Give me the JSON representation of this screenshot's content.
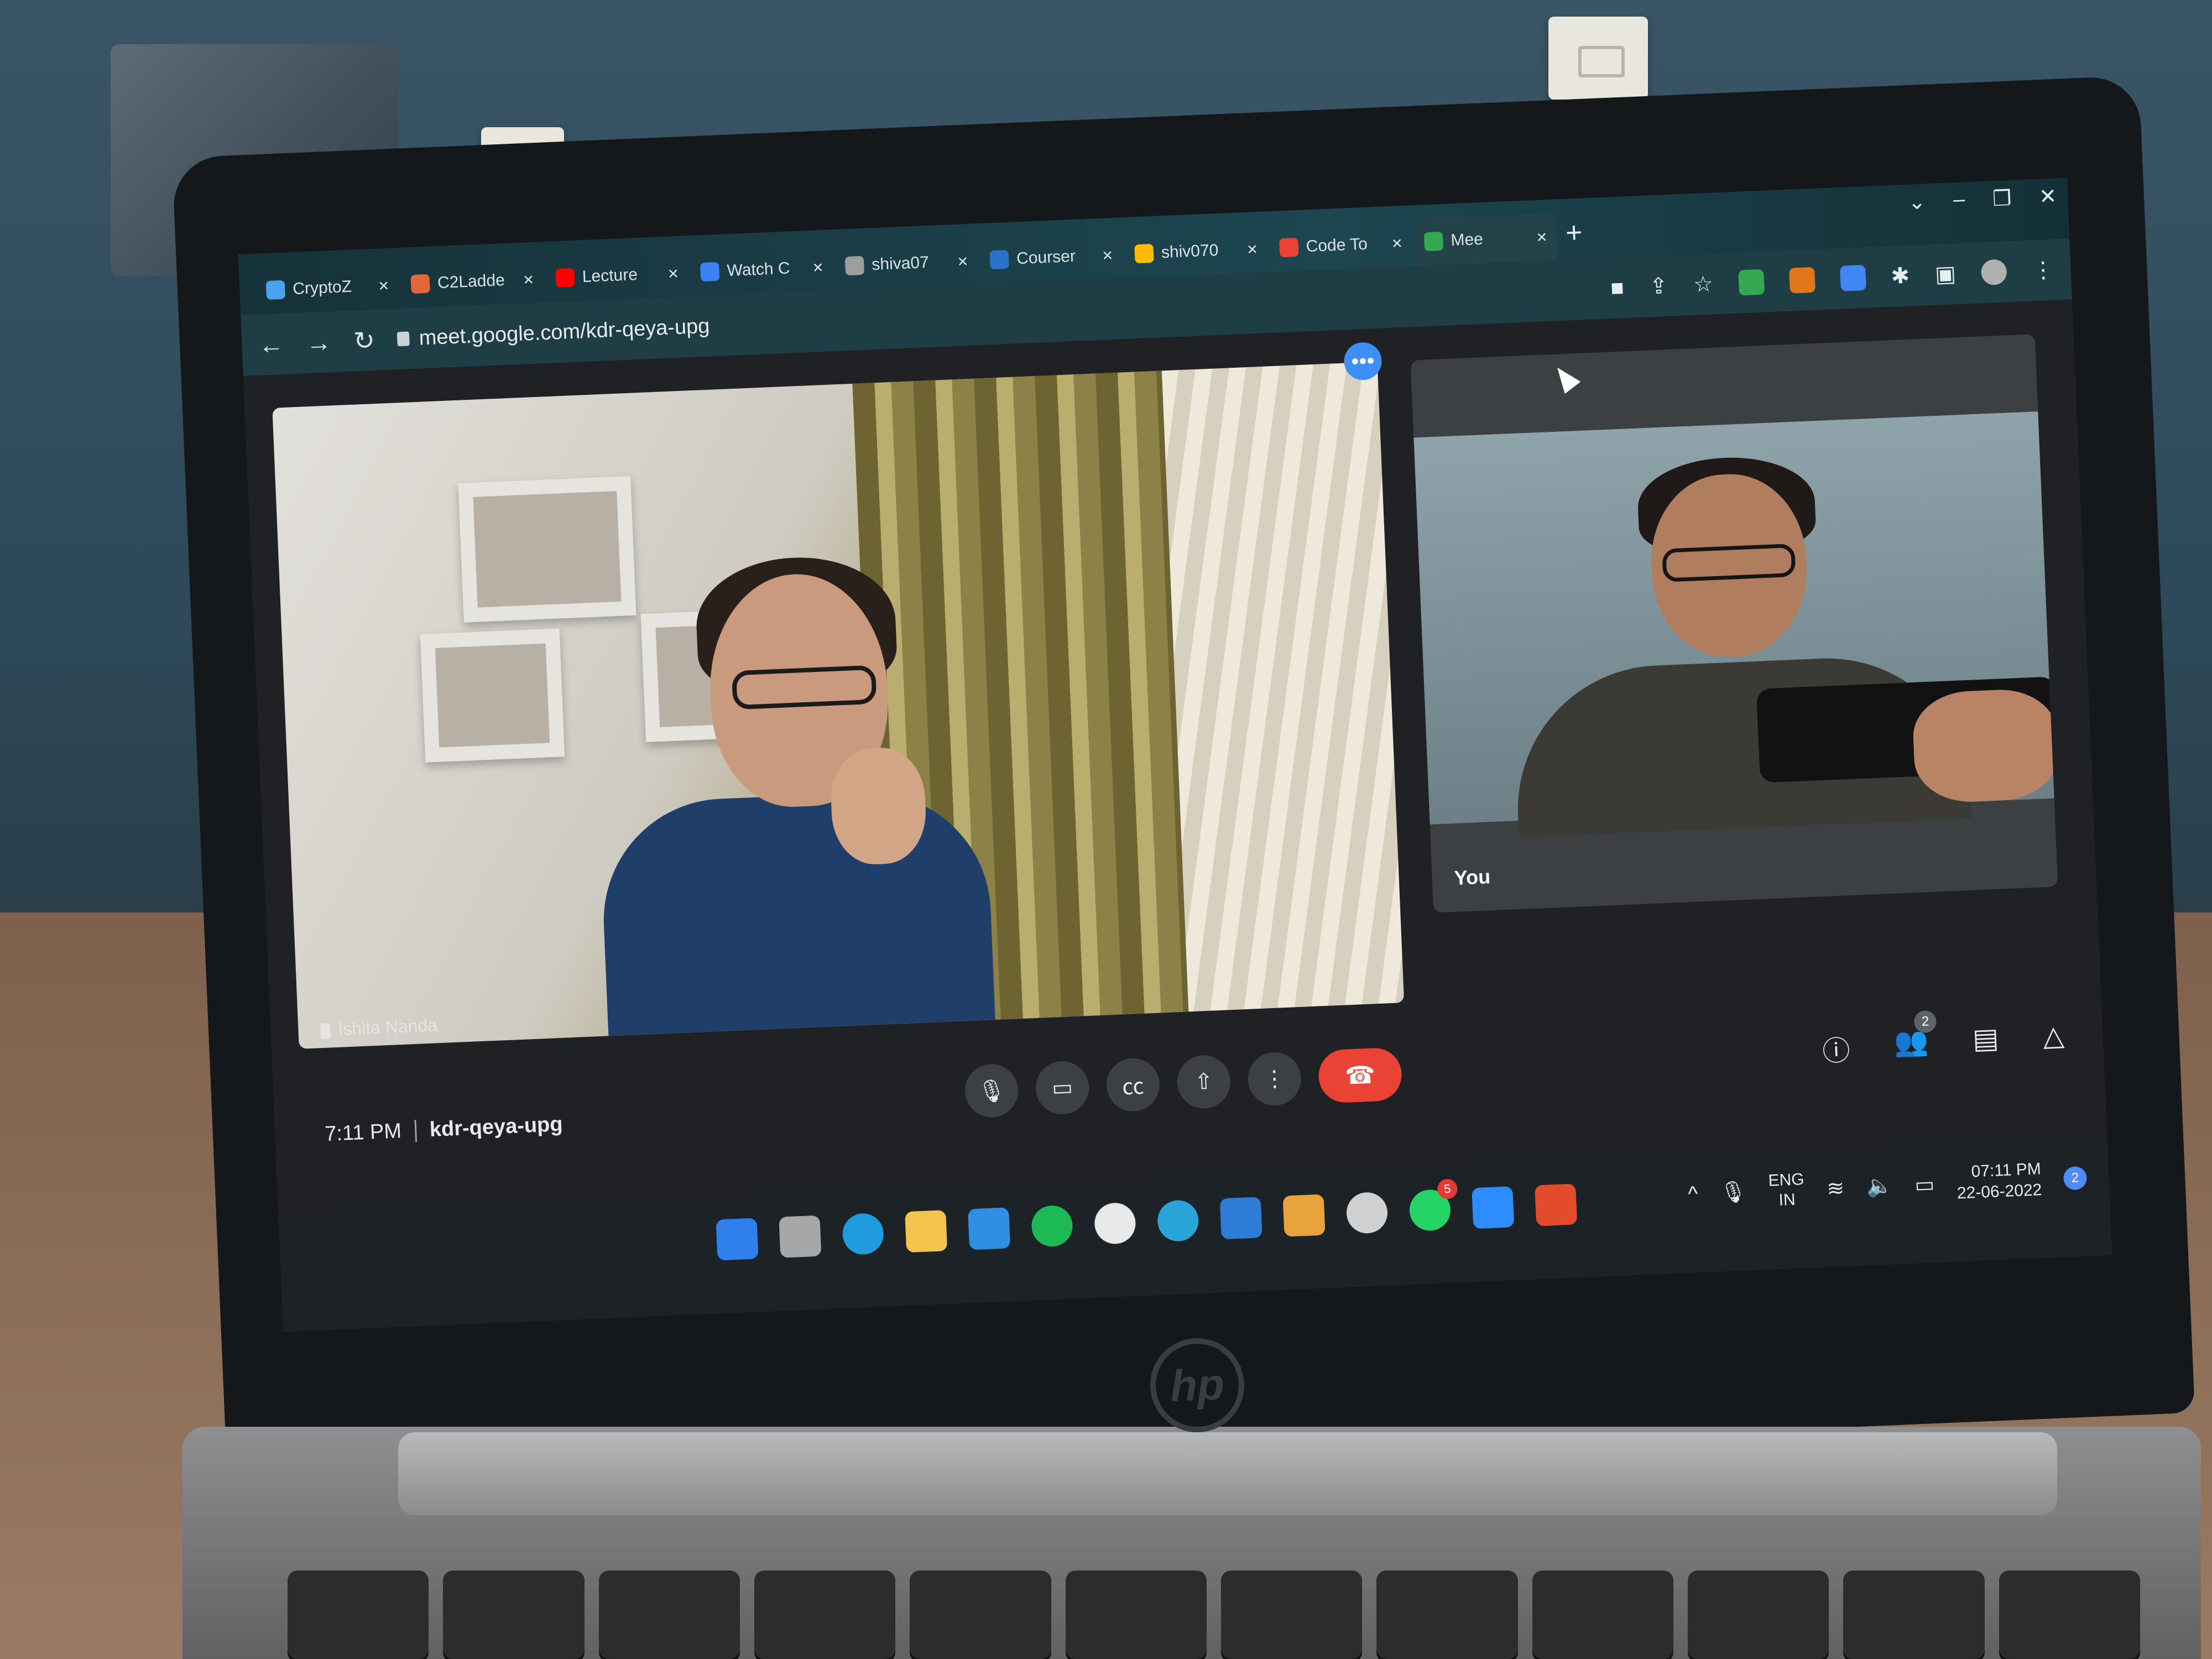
{
  "browser": {
    "tabs": [
      {
        "title": "CryptoZ",
        "favicon_color": "#4aa3f0",
        "close": "×"
      },
      {
        "title": "C2Ladde",
        "favicon_color": "#e0673a",
        "close": "×"
      },
      {
        "title": "Lecture",
        "favicon_color": "#ff0000",
        "close": "×"
      },
      {
        "title": "Watch C",
        "favicon_color": "#3b82f6",
        "close": "×"
      },
      {
        "title": "shiva07",
        "favicon_color": "#9e9e9e",
        "close": "×"
      },
      {
        "title": "Courser",
        "favicon_color": "#2a73cc",
        "close": "×"
      },
      {
        "title": "shiv070",
        "favicon_color": "#fbbc04",
        "close": "×"
      },
      {
        "title": "Code To",
        "favicon_color": "#ea4335",
        "close": "×"
      },
      {
        "title": "Mee",
        "favicon_color": "#34a853",
        "close": "×"
      }
    ],
    "new_tab": "+",
    "window_controls": [
      "⌄",
      "–",
      "❐",
      "✕"
    ],
    "url": "meet.google.com/kdr-qeya-upg",
    "toolbar_icons": [
      "camera-icon",
      "share-icon",
      "star-icon"
    ],
    "extension_colors": [
      "#34a853",
      "#e2761b",
      "#4285f4",
      "#b0b0b0"
    ]
  },
  "meet": {
    "main_participant": "Ishita Nanda",
    "self_label": "You",
    "time": "7:11 PM",
    "meeting_code": "kdr-qeya-upg",
    "people_count": "2",
    "control_icons": [
      "mic-icon",
      "camera-icon",
      "captions-icon",
      "present-icon",
      "more-icon",
      "end-call-icon"
    ],
    "right_icons": [
      "info-icon",
      "people-icon",
      "chat-icon",
      "activities-icon"
    ]
  },
  "taskbar": {
    "whatsapp_badge": "5",
    "lang_top": "ENG",
    "lang_bottom": "IN",
    "time": "07:11 PM",
    "date": "22-06-2022",
    "notifications": "2",
    "app_colors": [
      "#2f80ed",
      "#a7a7a7",
      "#1f9bde",
      "#f3c44b",
      "#2f8fe0",
      "#1db954",
      "#e8e8e8",
      "#2aa3d8",
      "#2d7cd6",
      "#e8a33c",
      "#d0d0d0",
      "#25d366",
      "#2d8cff",
      "#e24c2d"
    ]
  }
}
